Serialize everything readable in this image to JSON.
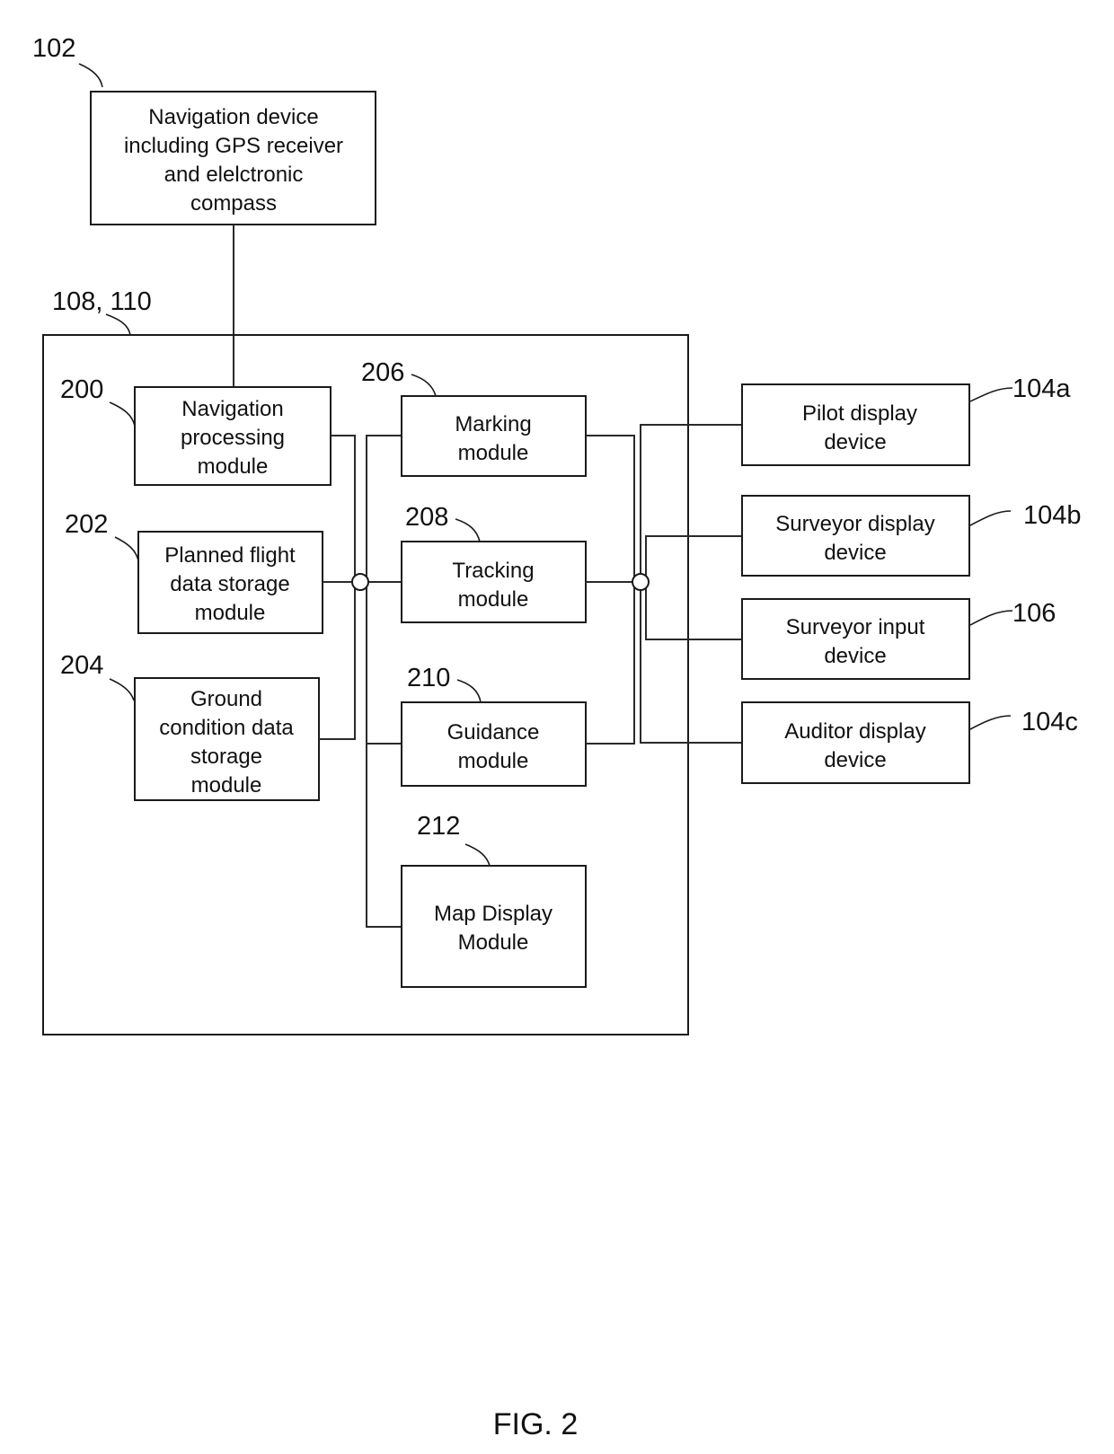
{
  "figure": {
    "caption": "FIG. 2"
  },
  "blocks": {
    "navigation_device": {
      "ref": "102",
      "lines": [
        "Navigation device",
        "including GPS receiver",
        "and elelctronic",
        "compass"
      ]
    },
    "system": {
      "ref": "108, 110"
    },
    "navigation_processing": {
      "ref": "200",
      "lines": [
        "Navigation",
        "processing",
        "module"
      ]
    },
    "planned_flight_storage": {
      "ref": "202",
      "lines": [
        "Planned flight",
        "data storage",
        "module"
      ]
    },
    "ground_condition_storage": {
      "ref": "204",
      "lines": [
        "Ground",
        "condition data",
        "storage",
        "module"
      ]
    },
    "marking": {
      "ref": "206",
      "lines": [
        "Marking",
        "module"
      ]
    },
    "tracking": {
      "ref": "208",
      "lines": [
        "Tracking",
        "module"
      ]
    },
    "guidance": {
      "ref": "210",
      "lines": [
        "Guidance",
        "module"
      ]
    },
    "map_display": {
      "ref": "212",
      "lines": [
        "Map Display",
        "Module"
      ]
    },
    "pilot_display": {
      "ref": "104a",
      "lines": [
        "Pilot display",
        "device"
      ]
    },
    "surveyor_display": {
      "ref": "104b",
      "lines": [
        "Surveyor display",
        "device"
      ]
    },
    "surveyor_input": {
      "ref": "106",
      "lines": [
        "Surveyor input",
        "device"
      ]
    },
    "auditor_display": {
      "ref": "104c",
      "lines": [
        "Auditor display",
        "device"
      ]
    }
  }
}
